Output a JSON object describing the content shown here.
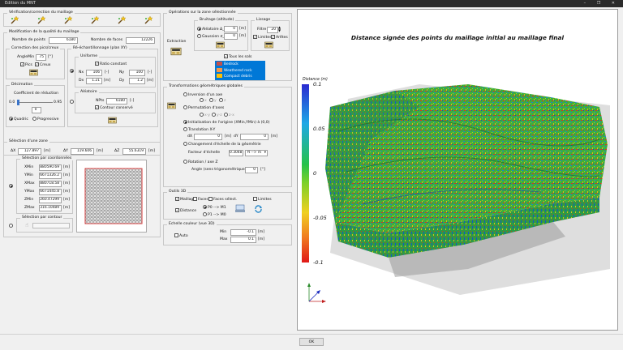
{
  "window": {
    "title": "Edition du MNT",
    "controls": "–  ❐  ✕"
  },
  "verif": {
    "title": "Vérification/correction du maillage",
    "icons": [
      "wand-icon",
      "wand-icon",
      "wand-icon",
      "wand-icon",
      "wand-icon",
      "wand-icon"
    ]
  },
  "modif": {
    "title": "Modification de la qualité du maillage",
    "nb_points_label": "Nombre de points",
    "nb_points": "6180",
    "nb_faces_label": "Nombre de faces",
    "nb_faces": "12226"
  },
  "pics": {
    "title": "Correction des pics/creux",
    "angle_label": "AngleMin",
    "angle": "75",
    "angle_unit": "[°]",
    "pics": "Pics",
    "creux": "Creux"
  },
  "decim": {
    "title": "Décimation",
    "coef_label": "Coefficient de réduction",
    "min": "0.0",
    "max": "0.95",
    "value": "0",
    "quadric": "Quadric",
    "progressive": "Progressive"
  },
  "reech": {
    "title": "Ré-échantillonnage (plan XY)",
    "uniforme": "Uniforme",
    "ratio": "Ratio constant",
    "nx_label": "Nx",
    "nx": "106",
    "nx_unit": "[-]",
    "ny_label": "Ny",
    "ny": "100",
    "ny_unit": "[-]",
    "dx_label": "Dx",
    "dx": "1.21",
    "dx_unit": "[m]",
    "dy_label": "Dy",
    "dy": "1.2",
    "dy_unit": "[m]",
    "aleatoire": "Aléatoire",
    "npts_label": "NPts",
    "npts": "6180",
    "npts_unit": "[-]",
    "contour": "Contour conservé"
  },
  "ops": {
    "title": "Opérations sur la zone sélectionnée",
    "bruitage": "Bruitage (altitude)",
    "aleatoire": "Aléatoire Δ_z",
    "aleatoire_val": "0",
    "aleatoire_unit": "[m]",
    "gaussien": "Gaussien σ_z",
    "gaussien_val": "0",
    "gaussien_unit": "[m]",
    "extraction": "Extraction",
    "lissage": "Lissage",
    "filtre_label": "Filtre",
    "filtre": "20",
    "limites": "Limites",
    "aretes": "Arêtes",
    "tous_sols": "Tous les sols",
    "sols": [
      {
        "name": "Bedrock",
        "color": "#c0504d"
      },
      {
        "name": "Weathered rock",
        "color": "#f79646"
      },
      {
        "name": "Compact debris",
        "color": "#ffc000"
      }
    ]
  },
  "transfo": {
    "title": "Transformations géométriques globales",
    "inversion": "Inversion d'un axe",
    "axes1": [
      "x",
      "y",
      "z"
    ],
    "permutation": "Permutation d'axes",
    "axes2": [
      "x-y",
      "y-z",
      "z-x"
    ],
    "init": "Initialisation de l'origine (XMin,YMin) à (0,0)",
    "translation": "Translation X-Y",
    "dx_label": "dX",
    "dx": "0",
    "dx_unit": "[m]",
    "dy_label": "dY",
    "dy": "0",
    "dy_unit": "[m]",
    "echelle": "Changement d'échelle de la géométrie",
    "facteur_label": "Facteur d'échelle",
    "facteur": "0.3048",
    "facteur_unit": "ft --> m",
    "rotation": "Rotation / axe Z",
    "angle_label": "Angle (sens trigonométrique)",
    "angle": "0",
    "angle_unit": "[°]"
  },
  "selection": {
    "title": "Sélection d'une zone",
    "dx_label": "ΔX",
    "dx": "127.897",
    "dx_unit": "[m]",
    "dy_label": "ΔY",
    "dy": "119.606",
    "dy_unit": "[m]",
    "dz_label": "ΔZ",
    "dz": "55.6319",
    "dz_unit": "[m]",
    "coords_title": "Sélection par coordonnées",
    "rows": [
      {
        "label": "XMin",
        "value": "880590.69",
        "unit": "[m]"
      },
      {
        "label": "YMin",
        "value": "6671326.2",
        "unit": "[m]"
      },
      {
        "label": "XMax",
        "value": "880718.58",
        "unit": "[m]"
      },
      {
        "label": "YMax",
        "value": "6671445.8",
        "unit": "[m]"
      },
      {
        "label": "ZMin",
        "value": "260.47299",
        "unit": "[m]"
      },
      {
        "label": "ZMax",
        "value": "316.10489",
        "unit": "[m]"
      }
    ],
    "contour_title": "Sélection par contour"
  },
  "outils": {
    "title": "Outils 3D",
    "maillage": "Maillage",
    "faces": "Faces",
    "faces_select": "Faces sélect.",
    "limites": "Limites",
    "distance": "Distance",
    "p0m1": "P0 --> M1",
    "p1m0": "P1 --> M0"
  },
  "echelle": {
    "title": "Echelle couleur (vue 3D)",
    "auto": "Auto",
    "min_label": "Min",
    "min": "-0.1",
    "min_unit": "[m]",
    "max_label": "Max",
    "max": "0.1",
    "max_unit": "[m]"
  },
  "view": {
    "title": "Distance signée des points du maillage initial au maillage final",
    "legend_title": "Distance (m)",
    "ticks": [
      "0.1",
      "0.05",
      "0",
      "-0.05",
      "-0.1"
    ]
  },
  "footer": {
    "ok": "OK"
  }
}
